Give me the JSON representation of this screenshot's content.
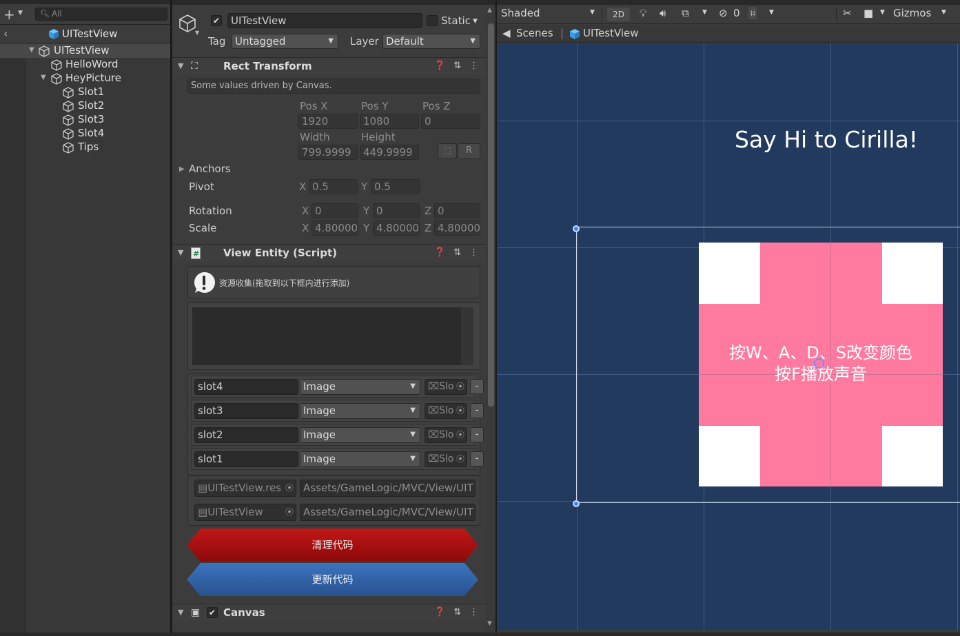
{
  "hierarchy": {
    "search_placeholder": "All",
    "scene_name": "UITestView",
    "nodes": [
      {
        "name": "UITestView"
      },
      {
        "name": "HelloWord"
      },
      {
        "name": "HeyPicture"
      },
      {
        "name": "Slot1"
      },
      {
        "name": "Slot2"
      },
      {
        "name": "Slot3"
      },
      {
        "name": "Slot4"
      },
      {
        "name": "Tips"
      }
    ]
  },
  "inspector": {
    "object_name": "UITestView",
    "active": true,
    "static_label": "Static",
    "tag_label": "Tag",
    "tag_value": "Untagged",
    "layer_label": "Layer",
    "layer_value": "Default",
    "rect_transform": {
      "title": "Rect Transform",
      "notice": "Some values driven by Canvas.",
      "pos_x_label": "Pos X",
      "pos_y_label": "Pos Y",
      "pos_z_label": "Pos Z",
      "pos_x": "1920",
      "pos_y": "1080",
      "pos_z": "0",
      "width_label": "Width",
      "height_label": "Height",
      "width": "799.9999",
      "height": "449.9999",
      "r_button": "R",
      "anchors_label": "Anchors",
      "pivot_label": "Pivot",
      "pivot_x": "0.5",
      "pivot_y": "0.5",
      "rotation_label": "Rotation",
      "rot_x": "0",
      "rot_y": "0",
      "rot_z": "0",
      "scale_label": "Scale",
      "scale_x": "4.80000",
      "scale_y": "4.80000",
      "scale_z": "4.80000",
      "x": "X",
      "y": "Y",
      "z": "Z"
    },
    "view_entity": {
      "title": "View Entity (Script)",
      "info_text": "资源收集(拖取到以下框内进行添加)",
      "slots": [
        {
          "name": "slot4",
          "type": "Image",
          "ref": "Slo"
        },
        {
          "name": "slot3",
          "type": "Image",
          "ref": "Slo"
        },
        {
          "name": "slot2",
          "type": "Image",
          "ref": "Slo"
        },
        {
          "name": "slot1",
          "type": "Image",
          "ref": "Slo"
        }
      ],
      "remove_label": "-",
      "files": [
        {
          "asset": "UITestView.res",
          "path": "Assets/GameLogic/MVC/View/UIT"
        },
        {
          "asset": "UITestView",
          "path": "Assets/GameLogic/MVC/View/UIT"
        }
      ],
      "clear_button": "清理代码",
      "update_button": "更新代码"
    },
    "canvas": {
      "title": "Canvas",
      "enabled": true
    }
  },
  "scene": {
    "shading_mode": "Shaded",
    "mode_2d": "2D",
    "hidden_count": "0",
    "gizmos_label": "Gizmos",
    "breadcrumb_scenes": "Scenes",
    "breadcrumb_object": "UITestView",
    "hello_text": "Say Hi to Cirilla!",
    "tips_line1": "按W、A、D、S改变颜色",
    "tips_line2": "按F播放声音",
    "colors": {
      "background": "#223a5e",
      "picture_cross": "#ff7a9e",
      "picture_base": "#ffffff",
      "clear_button": "#a80f10",
      "update_button": "#2f5fa6"
    }
  }
}
